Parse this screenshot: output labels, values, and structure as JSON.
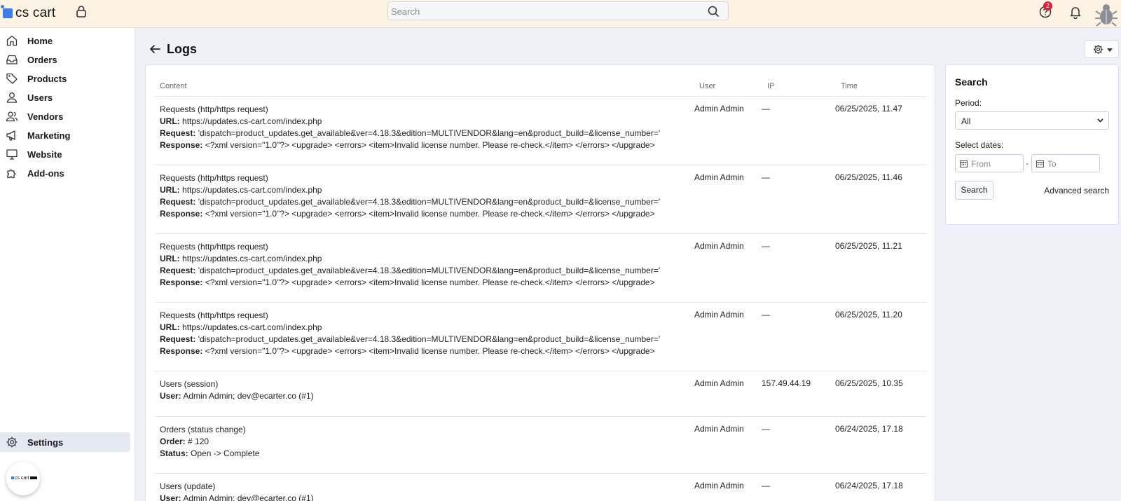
{
  "topbar": {
    "logo_text": "cs cart",
    "search_placeholder": "Search",
    "help_badge": "2"
  },
  "sidebar": {
    "items": [
      {
        "label": "Home"
      },
      {
        "label": "Orders"
      },
      {
        "label": "Products"
      },
      {
        "label": "Users"
      },
      {
        "label": "Vendors"
      },
      {
        "label": "Marketing"
      },
      {
        "label": "Website"
      },
      {
        "label": "Add-ons"
      }
    ],
    "settings_label": "Settings"
  },
  "page": {
    "title": "Logs"
  },
  "table": {
    "headers": {
      "content": "Content",
      "user": "User",
      "ip": "IP",
      "time": "Time"
    },
    "rows": [
      {
        "title": "Requests (http/https request)",
        "fields": [
          {
            "k": "URL:",
            "v": "https://updates.cs-cart.com/index.php"
          },
          {
            "k": "Request:",
            "v": "'dispatch=product_updates.get_available&ver=4.18.3&edition=MULTIVENDOR&lang=en&product_build=&license_number='"
          },
          {
            "k": "Response:",
            "v": "<?xml version=\"1.0\"?> <upgrade> <errors> <item>Invalid license number. Please re-check.</item> </errors> </upgrade>"
          }
        ],
        "user": "Admin Admin",
        "ip": "—",
        "time": "06/25/2025, 11.47"
      },
      {
        "title": "Requests (http/https request)",
        "fields": [
          {
            "k": "URL:",
            "v": "https://updates.cs-cart.com/index.php"
          },
          {
            "k": "Request:",
            "v": "'dispatch=product_updates.get_available&ver=4.18.3&edition=MULTIVENDOR&lang=en&product_build=&license_number='"
          },
          {
            "k": "Response:",
            "v": "<?xml version=\"1.0\"?> <upgrade> <errors> <item>Invalid license number. Please re-check.</item> </errors> </upgrade>"
          }
        ],
        "user": "Admin Admin",
        "ip": "—",
        "time": "06/25/2025, 11.46"
      },
      {
        "title": "Requests (http/https request)",
        "fields": [
          {
            "k": "URL:",
            "v": "https://updates.cs-cart.com/index.php"
          },
          {
            "k": "Request:",
            "v": "'dispatch=product_updates.get_available&ver=4.18.3&edition=MULTIVENDOR&lang=en&product_build=&license_number='"
          },
          {
            "k": "Response:",
            "v": "<?xml version=\"1.0\"?> <upgrade> <errors> <item>Invalid license number. Please re-check.</item> </errors> </upgrade>"
          }
        ],
        "user": "Admin Admin",
        "ip": "—",
        "time": "06/25/2025, 11.21"
      },
      {
        "title": "Requests (http/https request)",
        "fields": [
          {
            "k": "URL:",
            "v": "https://updates.cs-cart.com/index.php"
          },
          {
            "k": "Request:",
            "v": "'dispatch=product_updates.get_available&ver=4.18.3&edition=MULTIVENDOR&lang=en&product_build=&license_number='"
          },
          {
            "k": "Response:",
            "v": "<?xml version=\"1.0\"?> <upgrade> <errors> <item>Invalid license number. Please re-check.</item> </errors> </upgrade>"
          }
        ],
        "user": "Admin Admin",
        "ip": "—",
        "time": "06/25/2025, 11.20"
      },
      {
        "title": "Users (session)",
        "fields": [
          {
            "k": "User:",
            "v": "Admin Admin; dev@ecarter.co (#1)"
          }
        ],
        "user": "Admin Admin",
        "ip": "157.49.44.19",
        "time": "06/25/2025, 10.35"
      },
      {
        "title": "Orders (status change)",
        "fields": [
          {
            "k": "Order:",
            "v": "# 120"
          },
          {
            "k": "Status:",
            "v": "Open -> Complete"
          }
        ],
        "user": "Admin Admin",
        "ip": "—",
        "time": "06/24/2025, 17.18"
      },
      {
        "title": "Users (update)",
        "fields": [
          {
            "k": "User:",
            "v": "Admin Admin; dev@ecarter.co (#1)"
          }
        ],
        "user": "Admin Admin",
        "ip": "—",
        "time": "06/24/2025, 17.18"
      }
    ]
  },
  "search_panel": {
    "title": "Search",
    "period_label": "Period:",
    "period_value": "All",
    "dates_label": "Select dates:",
    "from_placeholder": "From",
    "to_placeholder": "To",
    "dash": "-",
    "search_button": "Search",
    "advanced_link": "Advanced search"
  }
}
